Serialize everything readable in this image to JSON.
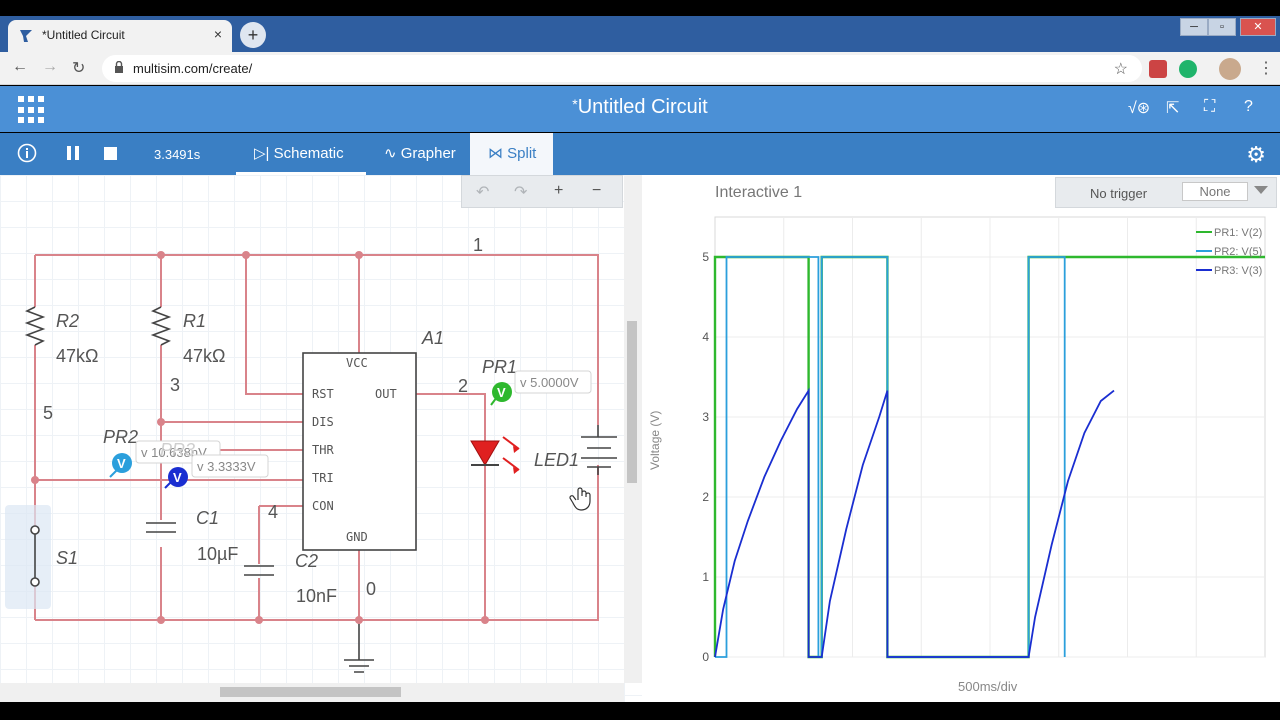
{
  "browser": {
    "tab_title": "*Untitled Circuit",
    "tab_close": "×",
    "new_tab": "+",
    "url": "multisim.com/create/",
    "win_minimize": "─",
    "win_maximize": "▫",
    "win_close": "✕"
  },
  "app": {
    "title_marker": "*",
    "title": "Untitled Circuit"
  },
  "toolbar": {
    "sim_time": "3.3491s",
    "tabs": [
      {
        "label": "Schematic",
        "icon": "schematic-icon"
      },
      {
        "label": "Grapher",
        "icon": "grapher-icon"
      },
      {
        "label": "Split",
        "icon": "split-icon",
        "active": true
      }
    ]
  },
  "schematic": {
    "zoom_plus": "+",
    "zoom_minus": "−",
    "components": {
      "r2_name": "R2",
      "r2_value": "47kΩ",
      "r1_name": "R1",
      "r1_value": "47kΩ",
      "c1_name": "C1",
      "c1_value": "10µF",
      "c2_name": "C2",
      "c2_value": "10nF",
      "s1_name": "S1",
      "a1_name": "A1",
      "led1_name": "LED1",
      "pr1_name": "PR1",
      "pr2_name": "PR2"
    },
    "pins": {
      "vcc": "VCC",
      "rst": "RST",
      "out": "OUT",
      "dis": "DIS",
      "thr": "THR",
      "tri": "TRI",
      "con": "CON",
      "gnd": "GND"
    },
    "nodes": {
      "n1": "1",
      "n2": "2",
      "n3": "3",
      "n4": "4",
      "n5": "5",
      "n0": "0"
    },
    "probes": {
      "pr1_reading": "v 5.0000V",
      "pr2_reading": "v 10.638nV",
      "pr2_hidden": "PR3",
      "pr3_reading": "v 3.3333V",
      "marker": "V"
    },
    "colors": {
      "wire": "#d9838a",
      "pr1": "#2eb82e",
      "pr2": "#2b9fdc",
      "pr3": "#1a2ed1",
      "led": "#e02020"
    }
  },
  "grapher": {
    "title": "Interactive 1",
    "trigger_label": "No trigger",
    "trigger_value": "None",
    "y_axis_label": "Voltage (V)",
    "x_axis_label": "500ms/div"
  },
  "chart_data": {
    "type": "line",
    "title": "Interactive 1",
    "xlabel": "500ms/div",
    "ylabel": "Voltage (V)",
    "ylim": [
      0,
      5.5
    ],
    "xlim": [
      0,
      3.35
    ],
    "yticks": [
      "0",
      "1",
      "2",
      "3",
      "4",
      "5"
    ],
    "grid": true,
    "legend_position": "top-right",
    "series": [
      {
        "name": "PR1: V(2)",
        "color": "#2eb82e",
        "x": [
          0,
          0.0001,
          0.57,
          0.5701,
          0.65,
          0.6501,
          1.05,
          1.0501,
          1.91,
          1.9101,
          3.35
        ],
        "y": [
          0,
          5,
          5,
          0,
          0,
          5,
          5,
          0,
          0,
          5,
          5
        ]
      },
      {
        "name": "PR2: V(5)",
        "color": "#2b9fdc",
        "x": [
          0,
          0.07,
          0.0701,
          0.63,
          0.6301,
          0.65,
          0.6501,
          1.05,
          1.0501,
          1.91,
          1.9101,
          2.13,
          2.1301
        ],
        "y": [
          0,
          0,
          5,
          5,
          0,
          0,
          5,
          5,
          0,
          0,
          5,
          5,
          0
        ]
      },
      {
        "name": "PR3: V(3)",
        "color": "#1a2ed1",
        "x": [
          0,
          0.05,
          0.12,
          0.2,
          0.3,
          0.4,
          0.5,
          0.57,
          0.5701,
          0.65,
          0.7,
          0.8,
          0.9,
          1.0,
          1.05,
          1.0501,
          1.91,
          1.95,
          2.05,
          2.15,
          2.25,
          2.35,
          2.43
        ],
        "y": [
          0,
          0.6,
          1.2,
          1.7,
          2.25,
          2.7,
          3.1,
          3.33,
          0,
          0,
          0.7,
          1.6,
          2.4,
          3.0,
          3.33,
          0,
          0,
          0.5,
          1.4,
          2.2,
          2.8,
          3.2,
          3.33
        ]
      }
    ]
  }
}
